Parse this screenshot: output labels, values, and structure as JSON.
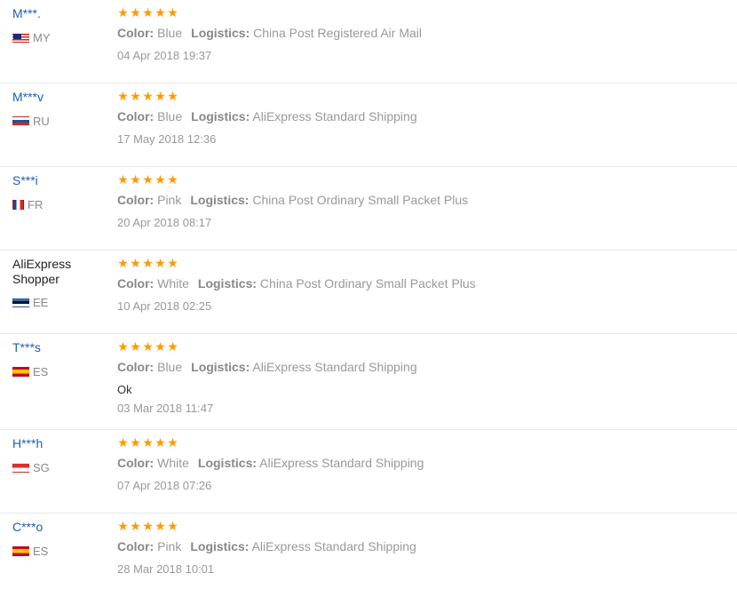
{
  "labels": {
    "color": "Color:",
    "logistics": "Logistics:"
  },
  "colors": {
    "buyer_link": "#1b5fb3",
    "star": "#ff9a00",
    "meta_text": "#999999",
    "divider": "#e8e8e8"
  },
  "reviews": [
    {
      "buyer": "M***.",
      "country": "MY",
      "flag": "malaysia-flag-icon",
      "stars": 5,
      "color": "Blue",
      "logistics": "China Post Registered Air Mail",
      "feedback": "",
      "date": "04 Apr 2018 19:37"
    },
    {
      "buyer": "M***v",
      "country": "RU",
      "flag": "russia-flag-icon",
      "stars": 5,
      "color": "Blue",
      "logistics": "AliExpress Standard Shipping",
      "feedback": "",
      "date": "17 May 2018 12:36"
    },
    {
      "buyer": "S***i",
      "country": "FR",
      "flag": "france-flag-icon",
      "stars": 5,
      "color": "Pink",
      "logistics": "China Post Ordinary Small Packet Plus",
      "feedback": "",
      "date": "20 Apr 2018 08:17"
    },
    {
      "buyer": "AliExpress Shopper",
      "country": "EE",
      "flag": "estonia-flag-icon",
      "stars": 5,
      "color": "White",
      "logistics": "China Post Ordinary Small Packet Plus",
      "feedback": "",
      "date": "10 Apr 2018 02:25"
    },
    {
      "buyer": "T***s",
      "country": "ES",
      "flag": "spain-flag-icon",
      "stars": 5,
      "color": "Blue",
      "logistics": "AliExpress Standard Shipping",
      "feedback": "Ok",
      "date": "03 Mar 2018 11:47"
    },
    {
      "buyer": "H***h",
      "country": "SG",
      "flag": "singapore-flag-icon",
      "stars": 5,
      "color": "White",
      "logistics": "AliExpress Standard Shipping",
      "feedback": "",
      "date": "07 Apr 2018 07:26"
    },
    {
      "buyer": "C***o",
      "country": "ES",
      "flag": "spain-flag-icon",
      "stars": 5,
      "color": "Pink",
      "logistics": "AliExpress Standard Shipping",
      "feedback": "",
      "date": "28 Mar 2018 10:01"
    }
  ]
}
